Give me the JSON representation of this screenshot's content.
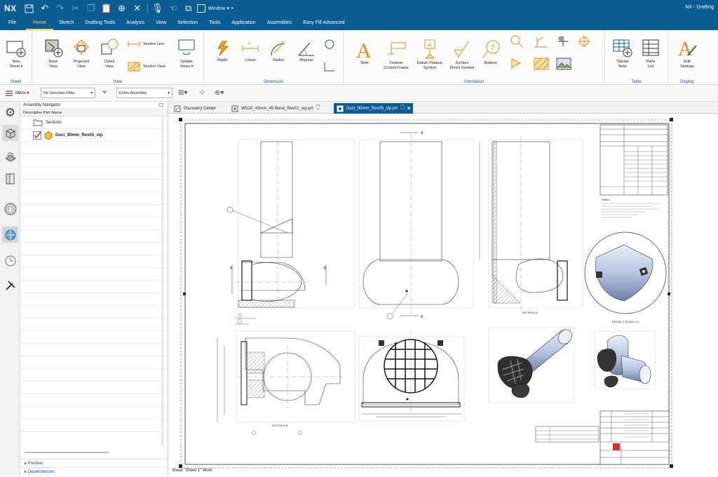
{
  "app": {
    "logo": "NX",
    "title": "NX - Drafting",
    "window_menu": "Window ▾ ≡"
  },
  "menu_tabs": [
    "File",
    "Home",
    "Sketch",
    "Drafting Tools",
    "Analysis",
    "View",
    "Selection",
    "Tools",
    "Application",
    "Assemblies",
    "Easy Fill Advanced"
  ],
  "active_tab": "Home",
  "ribbon": {
    "sheet": {
      "group": "Sheet",
      "new_sheet": "New\nSheet ▾"
    },
    "view": {
      "group": "View",
      "base_view": "Base\nView",
      "projected_view": "Projected\nView",
      "detail_view": "Detail\nView",
      "section_line": "Section Line",
      "section_view": "Section View",
      "update_views": "Update\nViews ▾"
    },
    "dimension": {
      "group": "Dimension",
      "rapid": "Rapid",
      "linear": "Linear",
      "radial": "Radial",
      "angular": "Angular"
    },
    "annotation": {
      "group": "Annotation",
      "note": "Note",
      "feature_control_frame": "Feature\nControl Frame",
      "datum_feature_symbol": "Datum Feature\nSymbol",
      "surface_finish_symbol": "Surface\nFinish Symbol",
      "balloon": "Balloon"
    },
    "table": {
      "group": "Table",
      "tabular_note": "Tabular\nNote",
      "parts_list": "Parts\nList"
    },
    "display": {
      "group": "Display",
      "edit_settings": "Edit\nSettings"
    }
  },
  "toolbar": {
    "menu_label": "Menu ▾",
    "selection_filter": "No Selection Filter",
    "scope": "Entire Assembly"
  },
  "navigator": {
    "title": "Assembly Navigator",
    "column": "Descriptive Part Name",
    "items": [
      "Sections",
      "Duct_90mm_Rev05_stp"
    ],
    "bottom": [
      "Preview",
      "Dependencies"
    ]
  },
  "doc_tabs": [
    "Discovery Center",
    "WS19_43mm_45 Bend_Rev01_stp.prt",
    "Duct_90mm_Rev05_stp.prt"
  ],
  "active_doc": "Duct_90mm_Rev05_stp.prt",
  "status": "Sheet \"Sheet 1\" Work",
  "drawing": {
    "section_a": "A",
    "section_b": "B",
    "section_aa": "SECTION A-A",
    "section_bb": "SECTION B-B",
    "detail_label": "DETAIL C\nSCALE 1:1",
    "notes_title": "Notes:",
    "colors": {
      "model": "#b9c9e6",
      "model_dark": "#6e82a8",
      "accent": "#0a5c92",
      "highlight": "#ffd24a"
    }
  }
}
